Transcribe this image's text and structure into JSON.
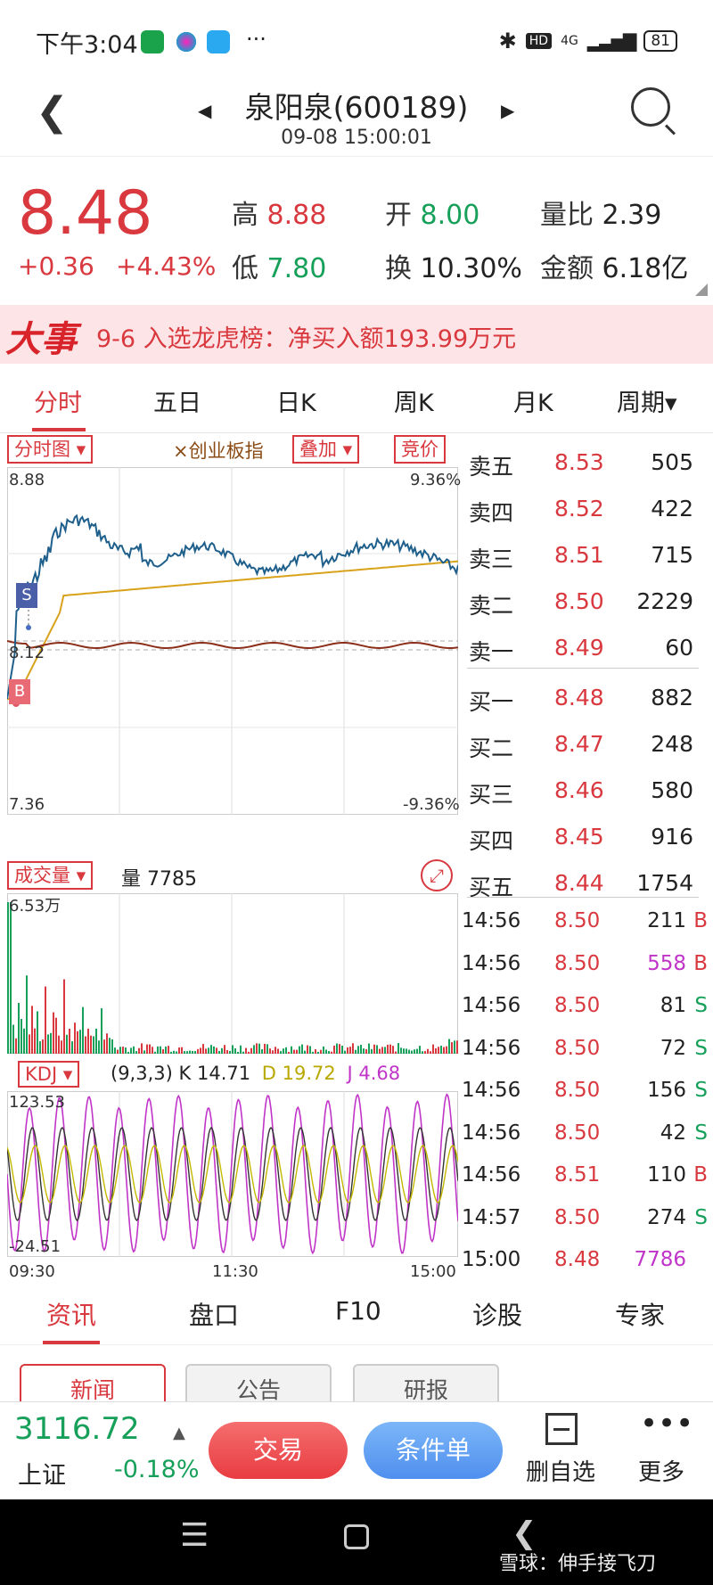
{
  "status": {
    "time": "下午3:04",
    "net": "4G",
    "hd": "HD",
    "battery": "81"
  },
  "header": {
    "title": "泉阳泉(600189)",
    "timestamp": "09-08 15:00:01"
  },
  "quote": {
    "price": "8.48",
    "change": "+0.36",
    "change_pct": "+4.43%",
    "high_label": "高",
    "high": "8.88",
    "low_label": "低",
    "low": "7.80",
    "open_label": "开",
    "open": "8.00",
    "turnover_label": "换",
    "turnover": "10.30%",
    "vol_ratio_label": "量比",
    "vol_ratio": "2.39",
    "amount_label": "金额",
    "amount": "6.18亿"
  },
  "event": {
    "tag": "大事",
    "text": "9-6 入选龙虎榜：净买入额193.99万元"
  },
  "tabs": [
    "分时",
    "五日",
    "日K",
    "周K",
    "月K",
    "周期▾"
  ],
  "chart": {
    "mode_label": "分时图 ▾",
    "index_label": "×创业板指",
    "overlay_label": "叠加 ▾",
    "auction_label": "竞价",
    "price_top": "8.88",
    "pct_top": "9.36%",
    "price_mid": "8.12",
    "price_bottom": "7.36",
    "pct_bottom": "-9.36%",
    "sell_marker": "S",
    "buy_marker": "B",
    "vol_label": "成交量 ▾",
    "vol_text": "量 7785",
    "vol_max": "6.53万",
    "kdj_label": "KDJ ▾",
    "kdj_params": "(9,3,3)",
    "k_label": "K",
    "k_val": "14.71",
    "d_label": "D",
    "d_val": "19.72",
    "j_label": "J",
    "j_val": "4.68",
    "kdj_max": "123.53",
    "kdj_min": "-24.51",
    "time_start": "09:30",
    "time_mid": "11:30",
    "time_end": "15:00"
  },
  "orderbook": [
    {
      "label": "卖五",
      "price": "8.53",
      "vol": "505"
    },
    {
      "label": "卖四",
      "price": "8.52",
      "vol": "422"
    },
    {
      "label": "卖三",
      "price": "8.51",
      "vol": "715"
    },
    {
      "label": "卖二",
      "price": "8.50",
      "vol": "2229"
    },
    {
      "label": "卖一",
      "price": "8.49",
      "vol": "60"
    },
    {
      "label": "买一",
      "price": "8.48",
      "vol": "882"
    },
    {
      "label": "买二",
      "price": "8.47",
      "vol": "248"
    },
    {
      "label": "买三",
      "price": "8.46",
      "vol": "580"
    },
    {
      "label": "买四",
      "price": "8.45",
      "vol": "916"
    },
    {
      "label": "买五",
      "price": "8.44",
      "vol": "1754"
    }
  ],
  "ticks": [
    {
      "time": "14:56",
      "price": "8.50",
      "vol": "211",
      "side": "B",
      "vol_color": "#222",
      "side_color": "#d8383e"
    },
    {
      "time": "14:56",
      "price": "8.50",
      "vol": "558",
      "side": "B",
      "vol_color": "#c035c8",
      "side_color": "#d8383e"
    },
    {
      "time": "14:56",
      "price": "8.50",
      "vol": "81",
      "side": "S",
      "vol_color": "#222",
      "side_color": "#17a05a"
    },
    {
      "time": "14:56",
      "price": "8.50",
      "vol": "72",
      "side": "S",
      "vol_color": "#222",
      "side_color": "#17a05a"
    },
    {
      "time": "14:56",
      "price": "8.50",
      "vol": "156",
      "side": "S",
      "vol_color": "#222",
      "side_color": "#17a05a"
    },
    {
      "time": "14:56",
      "price": "8.50",
      "vol": "42",
      "side": "S",
      "vol_color": "#222",
      "side_color": "#17a05a"
    },
    {
      "time": "14:56",
      "price": "8.51",
      "vol": "110",
      "side": "B",
      "vol_color": "#222",
      "side_color": "#d8383e"
    },
    {
      "time": "14:57",
      "price": "8.50",
      "vol": "274",
      "side": "S",
      "vol_color": "#222",
      "side_color": "#17a05a"
    },
    {
      "time": "15:00",
      "price": "8.48",
      "vol": "7786",
      "side": "",
      "vol_color": "#c035c8",
      "side_color": "#222"
    }
  ],
  "lower_tabs": [
    "资讯",
    "盘口",
    "F10",
    "诊股",
    "专家"
  ],
  "sub_tabs": [
    "新闻",
    "公告",
    "研报"
  ],
  "toolbar": {
    "index_value": "3116.72",
    "index_name": "上证",
    "index_pct": "-0.18%",
    "trade": "交易",
    "conditional": "条件单",
    "remove": "删自选",
    "more": "更多"
  },
  "watermark": "雪球：伸手接飞刀",
  "colors": {
    "up": "#d8383e",
    "down": "#17a05a",
    "price_line": "#1f5f8b",
    "avg_line": "#d9a21b",
    "index_line": "#8b2e1a"
  }
}
